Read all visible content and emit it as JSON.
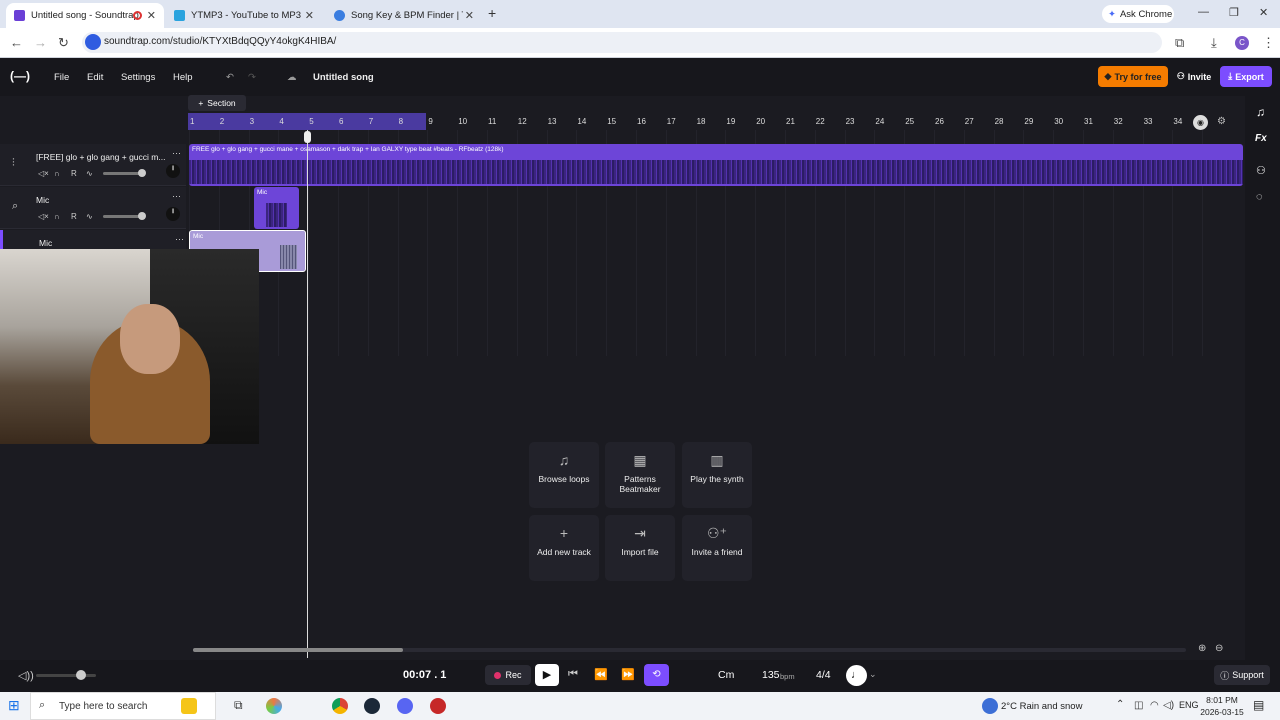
{
  "browser": {
    "tabs": [
      {
        "title": "Untitled song - Soundtrap",
        "active": true
      },
      {
        "title": "YTMP3 - YouTube to MP3 Conv",
        "active": false
      },
      {
        "title": "Song Key & BPM Finder | Tunel",
        "active": false
      }
    ],
    "new_tab": "+",
    "ask_chrome": "Ask Chrome",
    "url": "soundtrap.com/studio/KTYXtBdqQQyY4okgK4HIBA/",
    "profile_initial": "C"
  },
  "app": {
    "logo": "(—)",
    "menu": [
      "File",
      "Edit",
      "Settings",
      "Help"
    ],
    "song_title": "Untitled song",
    "try_free": "Try for free",
    "invite": "Invite",
    "export": "Export",
    "section_label": "Section",
    "ruler": [
      "1",
      "2",
      "3",
      "4",
      "5",
      "6",
      "7",
      "8",
      "9",
      "10",
      "11",
      "12",
      "13",
      "14",
      "15",
      "16",
      "17",
      "18",
      "19",
      "20",
      "21",
      "22",
      "23",
      "24",
      "25",
      "26",
      "27",
      "28",
      "29",
      "30",
      "31",
      "32",
      "33",
      "34"
    ]
  },
  "tracks": [
    {
      "name": "[FREE] glo + glo gang + gucci m...",
      "clip_title": "FREE glo + glo gang + gucci mane + osamason + dark trap + Ian GALXY type beat #beats - RFbeatz (128k)",
      "r_label": "R"
    },
    {
      "name": "Mic",
      "clip_title": "Mic",
      "r_label": "R"
    },
    {
      "name": "Mic",
      "clip_title": "Mic",
      "r_label": "R"
    }
  ],
  "tiles": [
    {
      "label": "Browse loops",
      "icon": "music-note-icon"
    },
    {
      "label": "Patterns Beatmaker",
      "icon": "patterns-icon"
    },
    {
      "label": "Play the synth",
      "icon": "piano-icon"
    },
    {
      "label": "Add new track",
      "icon": "plus-icon"
    },
    {
      "label": "Import file",
      "icon": "import-icon"
    },
    {
      "label": "Invite a friend",
      "icon": "add-person-icon"
    }
  ],
  "transport": {
    "time": "00:07 . 1",
    "rec": "Rec",
    "key": "Cm",
    "bpm": "135",
    "bpm_unit": "bpm",
    "signature": "4/4",
    "support": "Support"
  },
  "taskbar": {
    "search_placeholder": "Type here to search",
    "weather": "2°C  Rain and snow",
    "lang": "ENG",
    "time": "8:01 PM",
    "date": "2026-03-15"
  },
  "colors": {
    "accent": "#7c4dff",
    "clip": "#6d45d8",
    "try_free": "#f57c00"
  }
}
